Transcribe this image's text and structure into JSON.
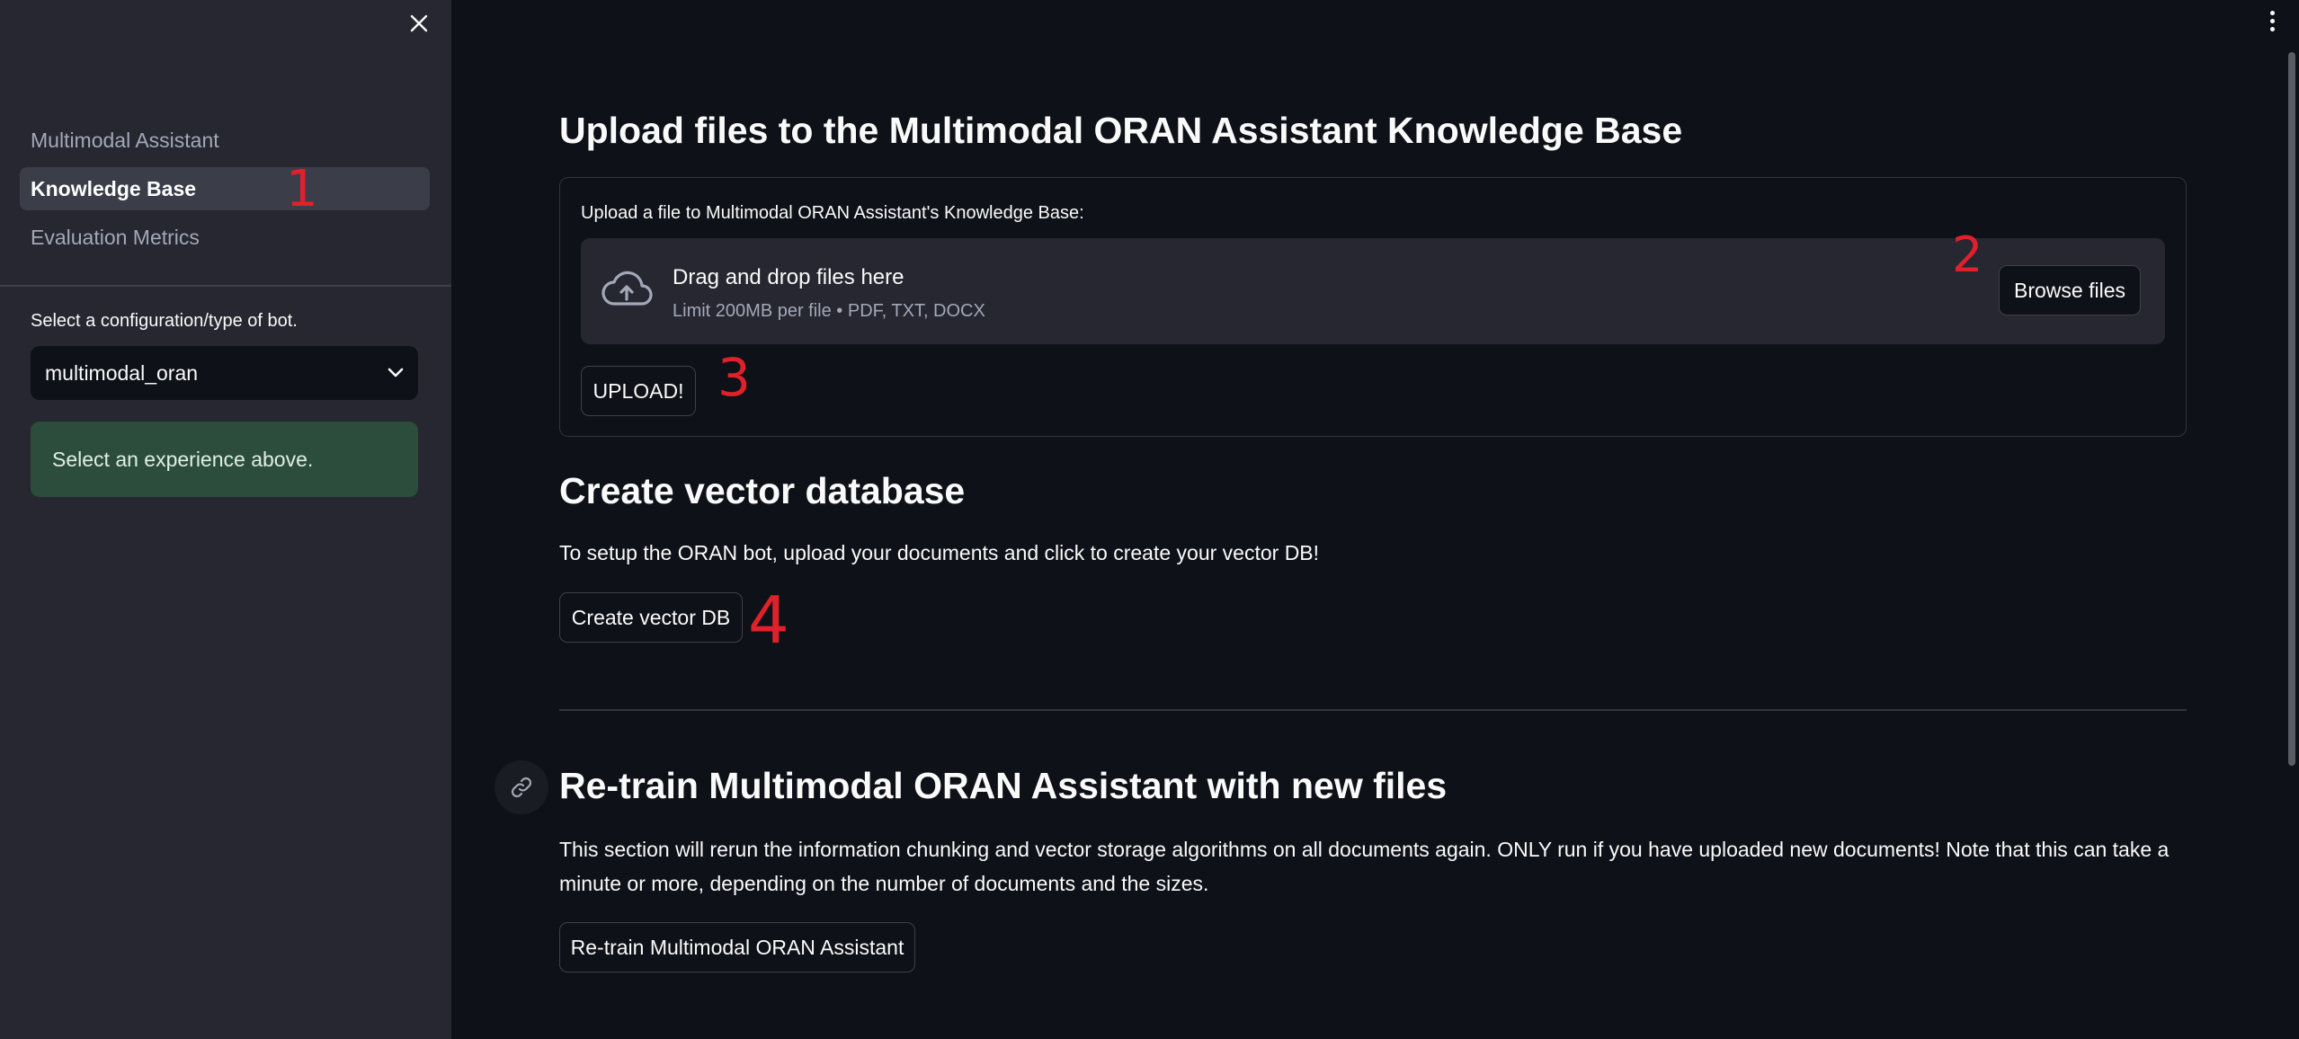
{
  "sidebar": {
    "nav_items": [
      {
        "label": "Multimodal Assistant",
        "active": false
      },
      {
        "label": "Knowledge Base",
        "active": true
      },
      {
        "label": "Evaluation Metrics",
        "active": false
      }
    ],
    "select_label": "Select a configuration/type of bot.",
    "select_value": "multimodal_oran",
    "info_message": "Select an experience above."
  },
  "upload_section": {
    "heading": "Upload files to the Multimodal ORAN Assistant Knowledge Base",
    "form_label": "Upload a file to Multimodal ORAN Assistant's Knowledge Base:",
    "dropzone_title": "Drag and drop files here",
    "dropzone_subtitle": "Limit 200MB per file • PDF, TXT, DOCX",
    "browse_label": "Browse files",
    "upload_label": "UPLOAD!"
  },
  "vector_section": {
    "heading": "Create vector database",
    "description": "To setup the ORAN bot, upload your documents and click to create your vector DB!",
    "button_label": "Create vector DB"
  },
  "retrain_section": {
    "heading": "Re-train Multimodal ORAN Assistant with new files",
    "description": "This section will rerun the information chunking and vector storage algorithms on all documents again. ONLY run if you have uploaded new documents! Note that this can take a minute or more, depending on the number of documents and the sizes.",
    "button_label": "Re-train Multimodal ORAN Assistant"
  },
  "annotations": {
    "a1": "1",
    "a2": "2",
    "a3": "3",
    "a4": "4"
  },
  "colors": {
    "background": "#0e1117",
    "sidebar": "#262730",
    "info_box": "#2c4d3b",
    "annotation": "#e0202a"
  }
}
